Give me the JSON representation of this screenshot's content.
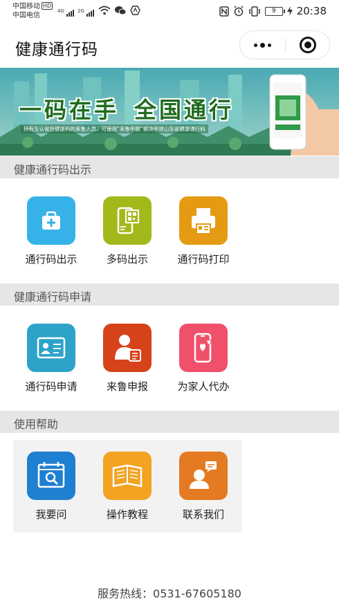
{
  "status_bar": {
    "carrier_1": "中国移动",
    "carrier_1_badge": "HD",
    "carrier_2": "中国电信",
    "network_1": "4G",
    "network_2": "2G",
    "battery": "9",
    "time": "20:38"
  },
  "nav": {
    "title": "健康通行码"
  },
  "banner": {
    "slogan_1": "一码在手",
    "slogan_2": "全国通行",
    "note": "持有互认省份健康码的来鲁人员，可使用“来鲁申报”模块申领山东省健康通行码"
  },
  "sections": [
    {
      "title": "健康通行码出示",
      "items": [
        {
          "label": "通行码出示",
          "icon": "medical-kit-icon",
          "color": "#36b2e8"
        },
        {
          "label": "多码出示",
          "icon": "qr-phone-icon",
          "color": "#a3b81b"
        },
        {
          "label": "通行码打印",
          "icon": "printer-icon",
          "color": "#e59a14"
        }
      ]
    },
    {
      "title": "健康通行码申请",
      "items": [
        {
          "label": "通行码申请",
          "icon": "id-card-icon",
          "color": "#2ea3c9"
        },
        {
          "label": "来鲁申报",
          "icon": "person-report-icon",
          "color": "#d6431b"
        },
        {
          "label": "为家人代办",
          "icon": "heart-phone-icon",
          "color": "#f0506a"
        }
      ]
    },
    {
      "title": "使用帮助",
      "items": [
        {
          "label": "我要问",
          "icon": "search-calendar-icon",
          "color": "#1f7fd1"
        },
        {
          "label": "操作教程",
          "icon": "book-icon",
          "color": "#f2a322"
        },
        {
          "label": "联系我们",
          "icon": "contact-chat-icon",
          "color": "#e47a22"
        }
      ]
    }
  ],
  "footer": {
    "hotline": "服务热线：0531-67605180"
  }
}
